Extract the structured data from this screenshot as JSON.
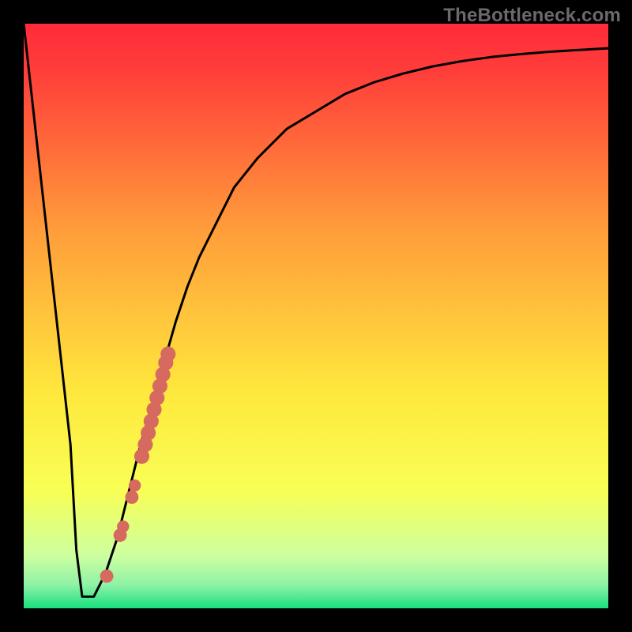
{
  "watermark": "TheBottleneck.com",
  "colors": {
    "frame": "#000000",
    "curve": "#000000",
    "points": "#d66a5f",
    "gradient_top": "#ff2b3a",
    "gradient_mid1": "#ffb23a",
    "gradient_mid2": "#fdf63d",
    "gradient_mid3": "#e8ff7a",
    "gradient_bottom": "#18e07e"
  },
  "chart_data": {
    "type": "line",
    "title": "",
    "xlabel": "",
    "ylabel": "",
    "xlim": [
      0,
      100
    ],
    "ylim": [
      0,
      100
    ],
    "series": [
      {
        "name": "bottleneck-curve",
        "x": [
          0,
          2,
          4,
          6,
          8,
          9,
          10,
          11,
          12,
          14,
          16,
          18,
          20,
          22,
          24,
          26,
          28,
          30,
          33,
          36,
          40,
          45,
          50,
          55,
          60,
          65,
          70,
          75,
          80,
          85,
          90,
          95,
          100
        ],
        "y": [
          100,
          82,
          64,
          46,
          28,
          10,
          2,
          2,
          2,
          6,
          12,
          20,
          28,
          35,
          42,
          49,
          55,
          60,
          66,
          72,
          77,
          82,
          85,
          88,
          90,
          91.5,
          92.7,
          93.6,
          94.3,
          94.8,
          95.2,
          95.5,
          95.8
        ]
      }
    ],
    "scatter_points": [
      {
        "x": 14.2,
        "y": 5.5,
        "r": 1.2
      },
      {
        "x": 16.5,
        "y": 12.5,
        "r": 1.2
      },
      {
        "x": 17.0,
        "y": 14.0,
        "r": 1.0
      },
      {
        "x": 18.5,
        "y": 19.0,
        "r": 1.2
      },
      {
        "x": 19.0,
        "y": 21.0,
        "r": 1.0
      },
      {
        "x": 20.2,
        "y": 26.0,
        "r": 1.5
      },
      {
        "x": 20.8,
        "y": 28.0,
        "r": 1.5
      },
      {
        "x": 21.3,
        "y": 30.0,
        "r": 1.5
      },
      {
        "x": 21.8,
        "y": 32.0,
        "r": 1.5
      },
      {
        "x": 22.3,
        "y": 34.0,
        "r": 1.5
      },
      {
        "x": 22.8,
        "y": 36.0,
        "r": 1.5
      },
      {
        "x": 23.3,
        "y": 38.0,
        "r": 1.5
      },
      {
        "x": 23.8,
        "y": 40.0,
        "r": 1.5
      },
      {
        "x": 24.3,
        "y": 42.0,
        "r": 1.5
      },
      {
        "x": 24.7,
        "y": 43.5,
        "r": 1.5
      }
    ],
    "gradient_stops": [
      {
        "offset": 0.0,
        "color": "#ff2b3a"
      },
      {
        "offset": 0.08,
        "color": "#ff3d3a"
      },
      {
        "offset": 0.35,
        "color": "#ff9c3a"
      },
      {
        "offset": 0.63,
        "color": "#ffe83d"
      },
      {
        "offset": 0.8,
        "color": "#f8ff55"
      },
      {
        "offset": 0.91,
        "color": "#cdffa0"
      },
      {
        "offset": 0.96,
        "color": "#8ff2a6"
      },
      {
        "offset": 1.0,
        "color": "#18e07e"
      }
    ]
  }
}
